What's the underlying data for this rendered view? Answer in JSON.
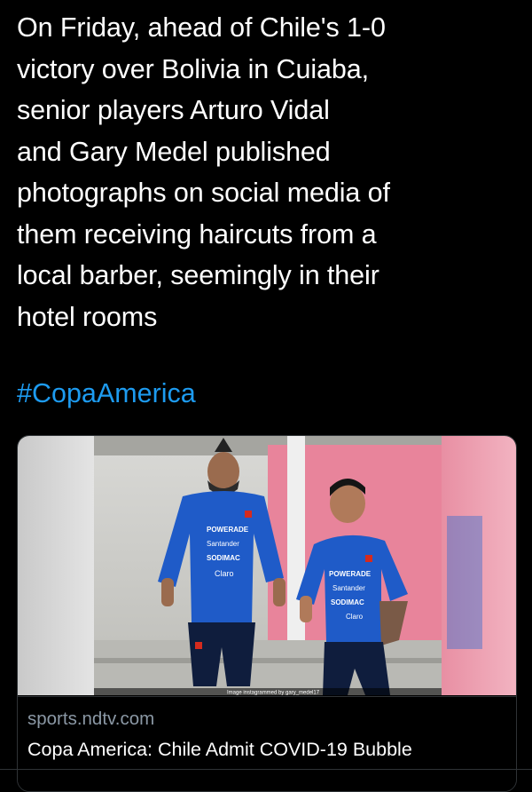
{
  "tweet": {
    "lines": [
      "On Friday, ahead of Chile's 1-0",
      "victory over Bolivia in Cuiaba,",
      "senior players Arturo Vidal",
      "and Gary Medel published",
      "photographs on social media of",
      "them receiving haircuts from a",
      "local barber, seemingly in their",
      "hotel rooms"
    ],
    "hashtag": "#CopaAmerica"
  },
  "card": {
    "image": {
      "watermark": "Image instagrammed by gary_medel17",
      "shirt_left": [
        "POWERADE",
        "Santander",
        "SODIMAC",
        "Claro"
      ],
      "shirt_right": [
        "POWERADE",
        "Santander",
        "SODIMAC",
        "Claro"
      ]
    },
    "domain": "sports.ndtv.com",
    "title": "Copa America: Chile Admit COVID-19 Bubble"
  },
  "colors": {
    "background": "#000000",
    "text": "#ffffff",
    "link": "#1d9bf0",
    "muted": "#8b98a5",
    "border": "#2f3336",
    "jersey": "#1f5bc8"
  }
}
